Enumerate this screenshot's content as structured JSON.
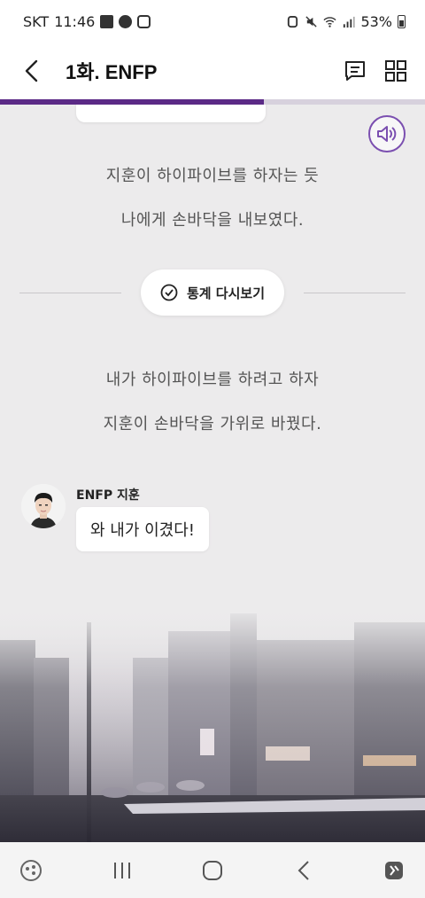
{
  "status_bar": {
    "carrier": "SKT",
    "time": "11:46",
    "battery": "53%",
    "icons": [
      "gallery-icon",
      "talk-icon",
      "instagram-icon",
      "alarm-icon",
      "mute-icon",
      "wifi-icon",
      "signal-icon",
      "battery-icon"
    ]
  },
  "header": {
    "title": "1화. ENFP",
    "back_icon": "back-chevron-icon",
    "actions": [
      "chat-list-icon",
      "grid-icon"
    ]
  },
  "progress": {
    "value": 0.62,
    "color": "#5b2a86"
  },
  "story": {
    "narration_1": [
      "지훈이 하이파이브를 하자는 듯",
      "나에게 손바닥을 내보였다."
    ],
    "stats_button": "통계 다시보기",
    "narration_2": [
      "내가 하이파이브를 하려고 하자",
      "지훈이 손바닥을 가위로 바꿨다."
    ],
    "chat": {
      "speaker": "ENFP 지훈",
      "message": "와 내가 이겼다!"
    }
  },
  "nav_bar": {
    "items": [
      "game-icon",
      "recent-apps-icon",
      "home-icon",
      "back-icon",
      "accessibility-icon"
    ]
  },
  "colors": {
    "accent": "#7b4fb0",
    "background": "#ecebec"
  }
}
